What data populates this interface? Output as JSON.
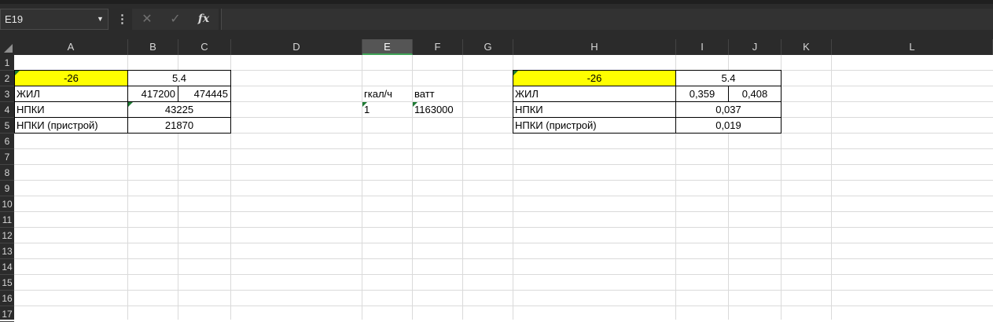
{
  "formula_bar": {
    "name_box": "E19",
    "fx_label": "fx",
    "cancel_label": "✕",
    "enter_label": "✓",
    "menu_label": "⋮",
    "formula": ""
  },
  "columns": [
    "A",
    "B",
    "C",
    "D",
    "E",
    "F",
    "G",
    "H",
    "I",
    "J",
    "K",
    "L"
  ],
  "selected_column": "E",
  "rows": [
    "1",
    "2",
    "3",
    "4",
    "5",
    "6",
    "7",
    "8",
    "9",
    "10",
    "11",
    "12",
    "13",
    "14",
    "15",
    "16",
    "17"
  ],
  "table_left": {
    "temp": "-26",
    "temp2": "5.4",
    "row3_label": "ЖИЛ",
    "row3_b": "417200",
    "row3_c": "474445",
    "row4_label": "НПКИ",
    "row4_value": "43225",
    "row5_label": "НПКИ (пристрой)",
    "row5_value": "21870"
  },
  "conversion": {
    "e_header": "гкал/ч",
    "f_header": "ватт",
    "e_value": "1",
    "f_value": "1163000"
  },
  "table_right": {
    "temp": "-26",
    "temp2": "5.4",
    "row3_label": "ЖИЛ",
    "row3_i": "0,359",
    "row3_j": "0,408",
    "row4_label": "НПКИ",
    "row4_value": "0,037",
    "row5_label": "НПКИ (пристрой)",
    "row5_value": "0,019"
  },
  "colors": {
    "highlight": "#ffff00",
    "selection_accent": "#3ea155",
    "indicator": "#1e7b34"
  }
}
